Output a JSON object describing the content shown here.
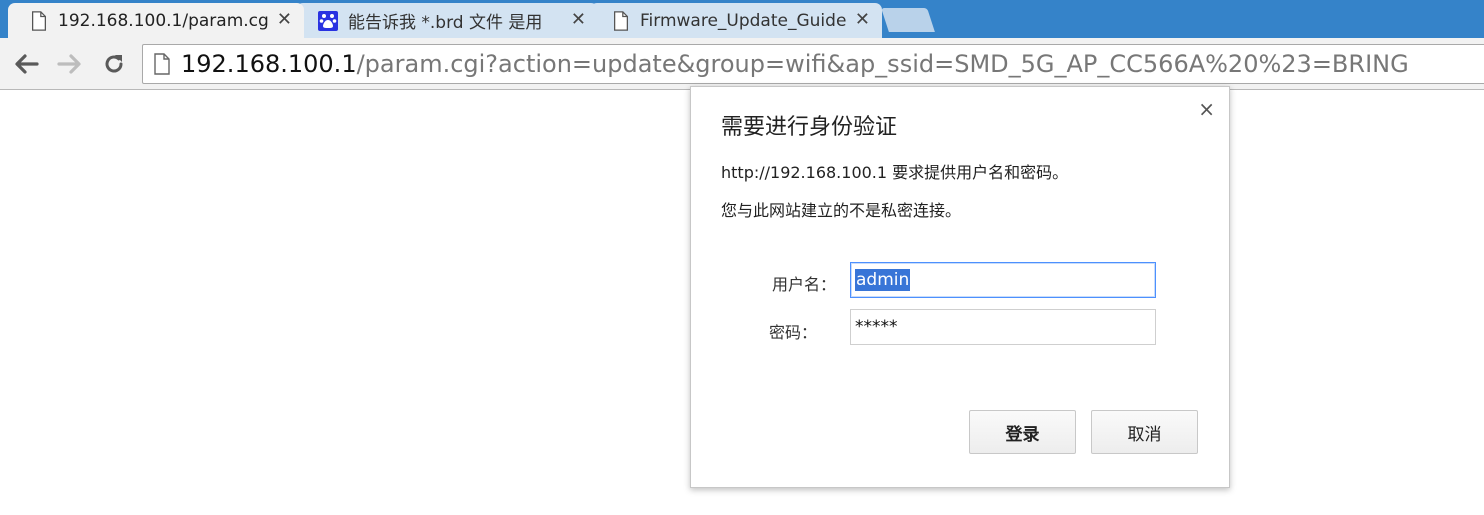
{
  "tabs": [
    {
      "title": "192.168.100.1/param.cg",
      "favicon": "page-icon",
      "active": true
    },
    {
      "title": "能告诉我 *.brd 文件 是用",
      "favicon": "baidu-paw-icon",
      "active": false
    },
    {
      "title": "Firmware_Update_Guide",
      "favicon": "page-icon",
      "active": false
    }
  ],
  "tab_close_glyph": "✕",
  "address": {
    "host": "192.168.100.1",
    "path": "/param.cgi?action=update&group=wifi&ap_ssid=SMD_5G_AP_CC566A%20%23=BRING"
  },
  "dialog": {
    "close_glyph": "×",
    "title": "需要进行身份验证",
    "line1": "http://192.168.100.1 要求提供用户名和密码。",
    "line2": "您与此网站建立的不是私密连接。",
    "username_label": "用户名：",
    "username_value": "admin",
    "password_label": "密码：",
    "password_value": "*****",
    "login_label": "登录",
    "cancel_label": "取消"
  },
  "colors": {
    "tabstrip": "#3583c9",
    "accent_focus": "#4d90fe",
    "selection": "#3875d7"
  }
}
